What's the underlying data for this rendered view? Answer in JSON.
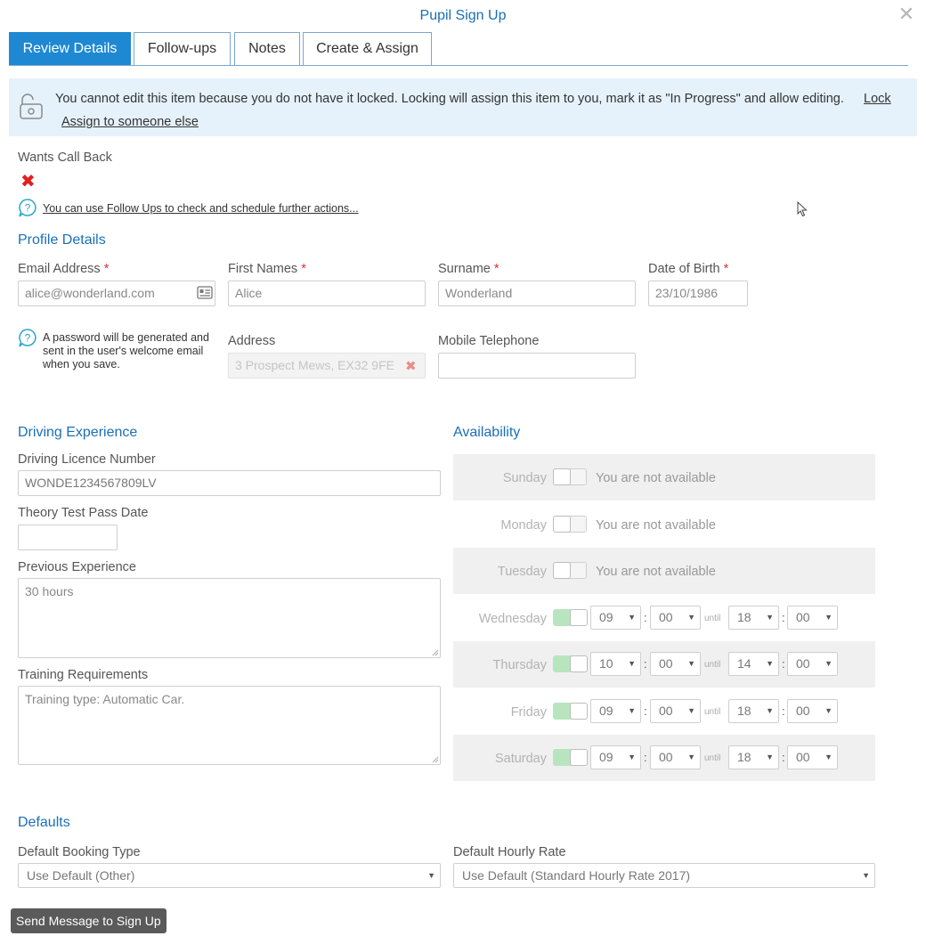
{
  "dialog": {
    "title": "Pupil Sign Up"
  },
  "tabs": [
    {
      "label": "Review Details"
    },
    {
      "label": "Follow-ups"
    },
    {
      "label": "Notes"
    },
    {
      "label": "Create & Assign"
    }
  ],
  "lock_notice": {
    "message": "You cannot edit this item because you do not have it locked. Locking will assign this item to you, mark it as \"In Progress\" and allow editing.",
    "lock_link": "Lock",
    "assign_link": "Assign to someone else"
  },
  "call_back": {
    "label": "Wants Call Back",
    "followup_hint": "You can use Follow Ups to check and schedule further actions..."
  },
  "profile": {
    "heading": "Profile Details",
    "email_label": "Email Address",
    "email_value": "alice@wonderland.com",
    "first_names_label": "First Names",
    "first_names_value": "Alice",
    "surname_label": "Surname",
    "surname_value": "Wonderland",
    "dob_label": "Date of Birth",
    "dob_value": "23/10/1986",
    "required_mark": "*",
    "password_note": "A password will be generated and sent in the user's welcome email when you save.",
    "address_label": "Address",
    "address_value": "3 Prospect Mews, EX32 9FE",
    "mobile_label": "Mobile Telephone",
    "mobile_value": ""
  },
  "driving": {
    "heading": "Driving Experience",
    "licence_label": "Driving Licence Number",
    "licence_value": "WONDE1234567809LV",
    "theory_label": "Theory Test Pass Date",
    "theory_value": "",
    "previous_label": "Previous Experience",
    "previous_value": "30 hours",
    "training_label": "Training Requirements",
    "training_value": "Training type: Automatic Car."
  },
  "availability": {
    "heading": "Availability",
    "not_available_text": "You are not available",
    "until_text": "until",
    "colon": ":",
    "days": [
      {
        "day": "Sunday",
        "available": false
      },
      {
        "day": "Monday",
        "available": false
      },
      {
        "day": "Tuesday",
        "available": false
      },
      {
        "day": "Wednesday",
        "available": true,
        "from_h": "09",
        "from_m": "00",
        "to_h": "18",
        "to_m": "00"
      },
      {
        "day": "Thursday",
        "available": true,
        "from_h": "10",
        "from_m": "00",
        "to_h": "14",
        "to_m": "00"
      },
      {
        "day": "Friday",
        "available": true,
        "from_h": "09",
        "from_m": "00",
        "to_h": "18",
        "to_m": "00"
      },
      {
        "day": "Saturday",
        "available": true,
        "from_h": "09",
        "from_m": "00",
        "to_h": "18",
        "to_m": "00"
      }
    ]
  },
  "defaults": {
    "heading": "Defaults",
    "booking_type_label": "Default Booking Type",
    "booking_type_value": "Use Default (Other)",
    "hourly_rate_label": "Default Hourly Rate",
    "hourly_rate_value": "Use Default (Standard Hourly Rate 2017)"
  },
  "actions": {
    "send_button": "Send Message to Sign Up"
  }
}
